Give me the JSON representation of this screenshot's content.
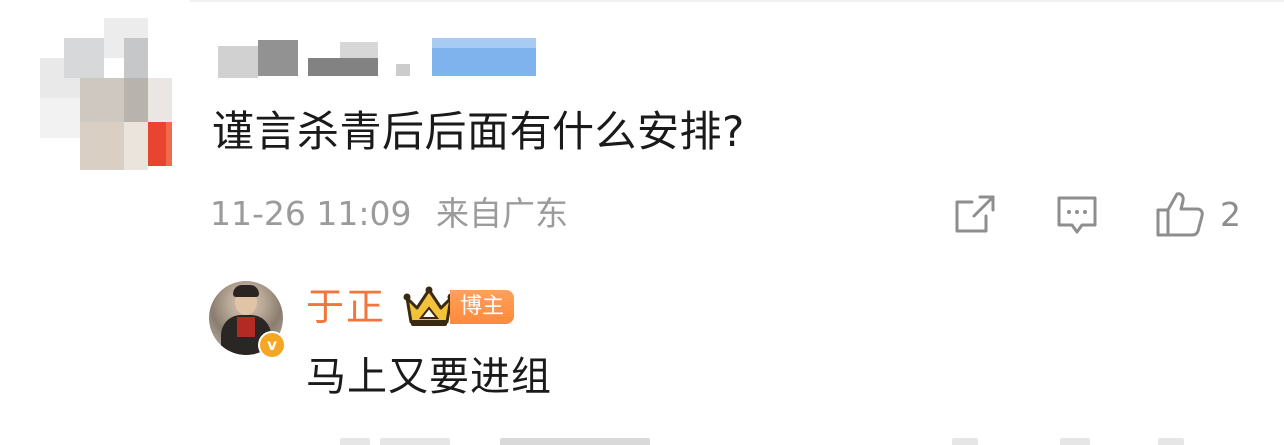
{
  "comment": {
    "text": "谨言杀青后后面有什么安排?",
    "date": "11-26 11:09",
    "location": "来自广东",
    "like_count": "2"
  },
  "reply": {
    "author": "于正",
    "badge": "博主",
    "verified_mark": "v",
    "text": "马上又要进组"
  },
  "icons": {
    "share": "share-icon",
    "reply": "comment-icon",
    "like": "thumbs-up-icon",
    "crown": "crown-icon",
    "verified": "verified-badge-icon"
  },
  "colors": {
    "author_name": "#f2763c",
    "badge_bg": "#ff8a3d",
    "meta_text": "#9b9b9b",
    "body_text": "#1a1a1a"
  }
}
